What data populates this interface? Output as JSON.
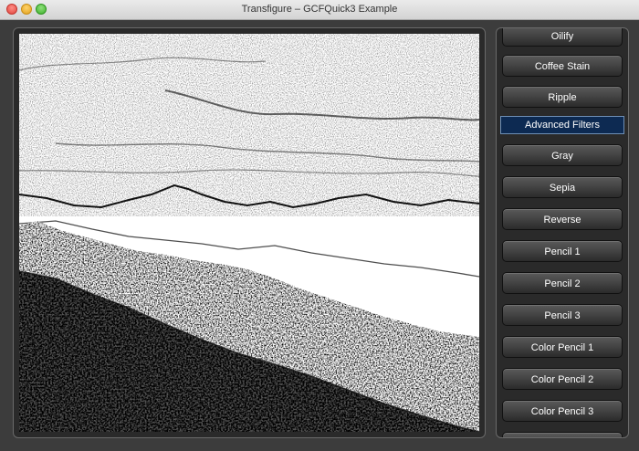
{
  "window": {
    "title": "Transfigure – GCFQuick3 Example"
  },
  "filters": {
    "basic": [
      "Oilify",
      "Coffee Stain",
      "Ripple"
    ],
    "section_label": "Advanced Filters",
    "advanced": [
      "Gray",
      "Sepia",
      "Reverse",
      "Pencil 1",
      "Pencil 2",
      "Pencil 3",
      "Color Pencil 1",
      "Color Pencil 2",
      "Color Pencil 3"
    ]
  },
  "image": {
    "description_icon": "landscape-sketch-image"
  }
}
